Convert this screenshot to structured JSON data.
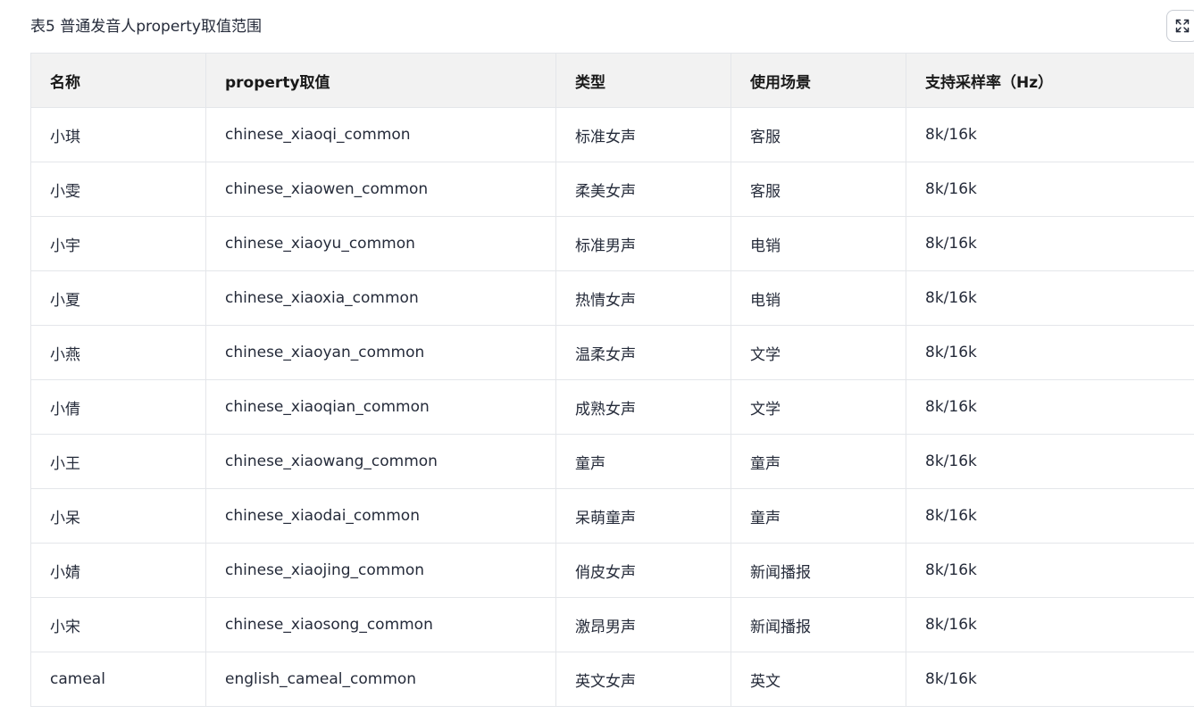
{
  "caption": "表5 普通发音人property取值范围",
  "expand_button": {
    "icon": "expand-icon"
  },
  "table": {
    "headers": [
      "名称",
      "property取值",
      "类型",
      "使用场景",
      "支持采样率（Hz）"
    ],
    "rows": [
      [
        "小琪",
        "chinese_xiaoqi_common",
        "标准女声",
        "客服",
        "8k/16k"
      ],
      [
        "小雯",
        "chinese_xiaowen_common",
        "柔美女声",
        "客服",
        "8k/16k"
      ],
      [
        "小宇",
        "chinese_xiaoyu_common",
        "标准男声",
        "电销",
        "8k/16k"
      ],
      [
        "小夏",
        "chinese_xiaoxia_common",
        "热情女声",
        "电销",
        "8k/16k"
      ],
      [
        "小燕",
        "chinese_xiaoyan_common",
        "温柔女声",
        "文学",
        "8k/16k"
      ],
      [
        "小倩",
        "chinese_xiaoqian_common",
        "成熟女声",
        "文学",
        "8k/16k"
      ],
      [
        "小王",
        "chinese_xiaowang_common",
        "童声",
        "童声",
        "8k/16k"
      ],
      [
        "小呆",
        "chinese_xiaodai_common",
        "呆萌童声",
        "童声",
        "8k/16k"
      ],
      [
        "小婧",
        "chinese_xiaojing_common",
        "俏皮女声",
        "新闻播报",
        "8k/16k"
      ],
      [
        "小宋",
        "chinese_xiaosong_common",
        "激昂男声",
        "新闻播报",
        "8k/16k"
      ],
      [
        "cameal",
        "english_cameal_common",
        "英文女声",
        "英文",
        "8k/16k"
      ]
    ]
  }
}
